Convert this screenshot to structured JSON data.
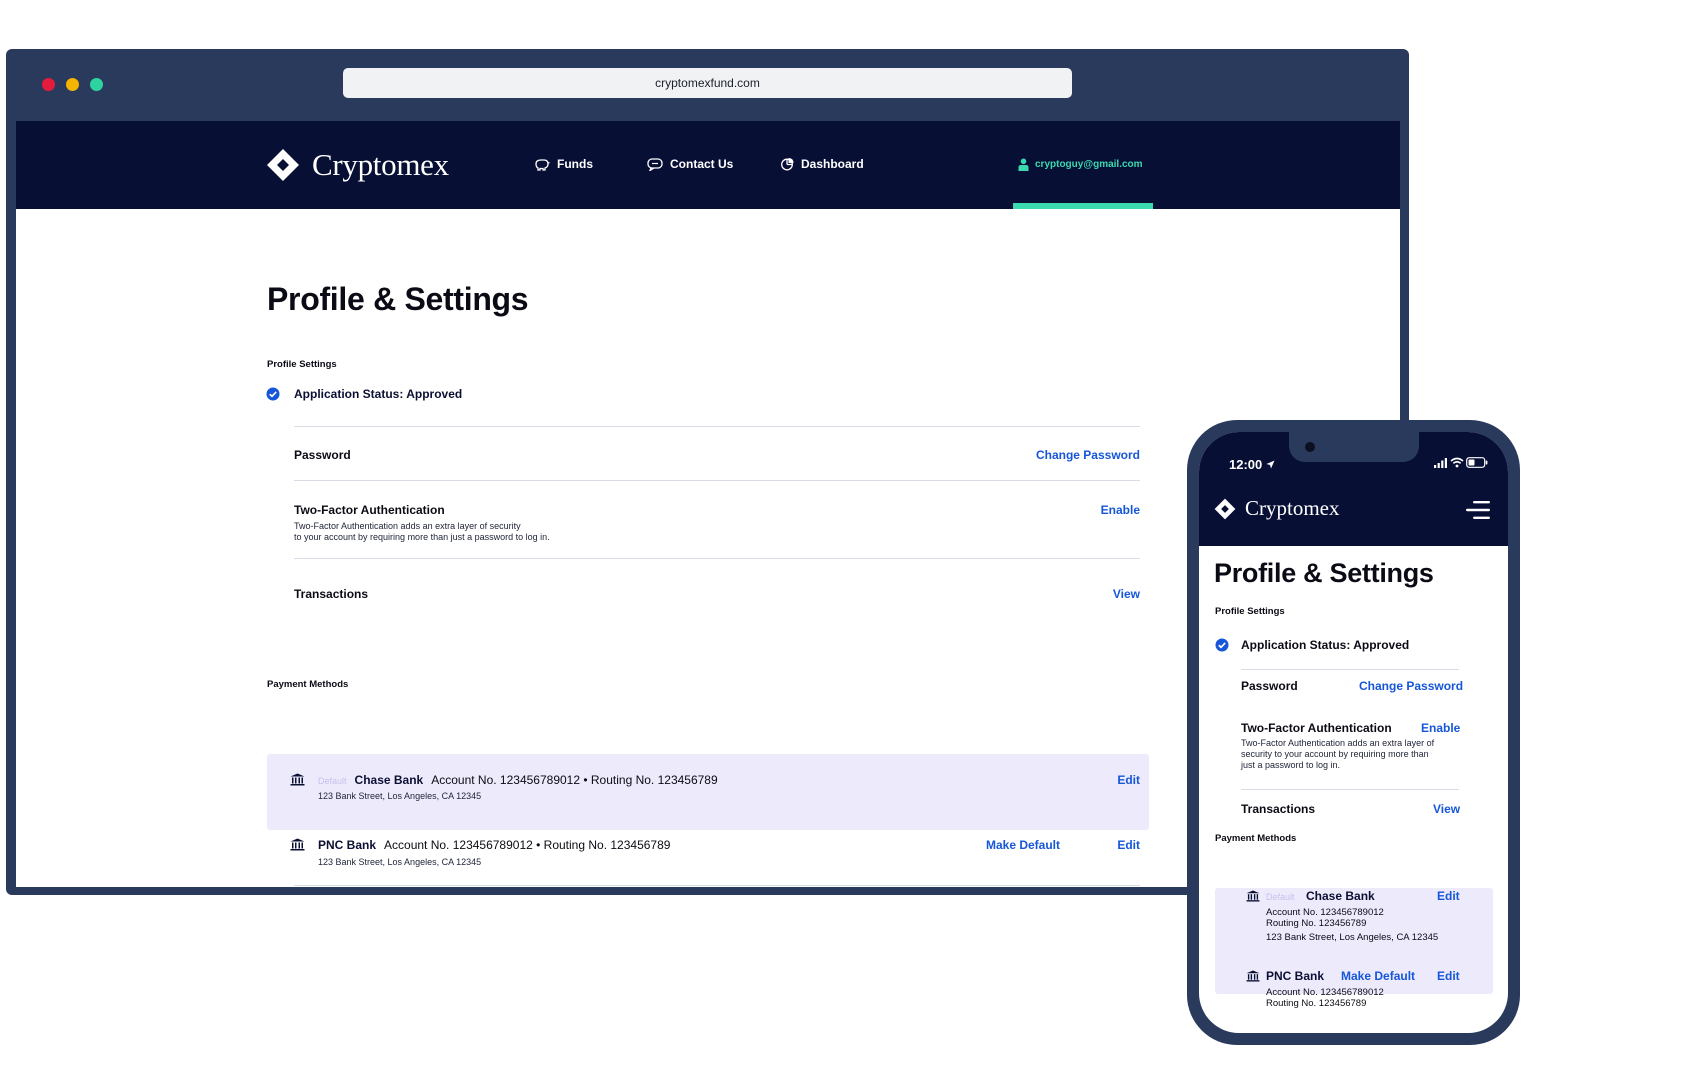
{
  "browser": {
    "url": "cryptomexfund.com",
    "dots": [
      "#e51b3e",
      "#f4b400",
      "#2ed3a0"
    ]
  },
  "nav": {
    "brand": "Cryptomex",
    "items": [
      {
        "label": "Funds",
        "icon": "piggy-bank-icon"
      },
      {
        "label": "Contact Us",
        "icon": "chat-bubble-icon"
      },
      {
        "label": "Dashboard",
        "icon": "pie-chart-icon"
      }
    ],
    "user_email": "cryptoguy@gmail.com",
    "accent": "#3ad9b0"
  },
  "page": {
    "title": "Profile & Settings",
    "profile_section_label": "Profile Settings",
    "status": "Application Status: Approved",
    "rows": [
      {
        "label": "Password",
        "action": "Change Password"
      },
      {
        "label": "Two-Factor Authentication",
        "action": "Enable",
        "desc_line1": "Two-Factor Authentication adds an extra layer of security",
        "desc_line2": "to your account by requiring more than just a password to log in."
      },
      {
        "label": "Transactions",
        "action": "View"
      }
    ],
    "payment_section_label": "Payment Methods",
    "payments": [
      {
        "default_tag": "Default",
        "bank": "Chase Bank",
        "account": "Account No. 123456789012 • Routing No. 123456789",
        "address": "123 Bank Street, Los Angeles, CA 12345",
        "edit": "Edit"
      },
      {
        "bank": "PNC Bank",
        "account": "Account No. 123456789012 • Routing No. 123456789",
        "address": "123 Bank Street, Los Angeles, CA 12345",
        "make_default": "Make Default",
        "edit": "Edit"
      }
    ]
  },
  "phone": {
    "time": "12:00",
    "brand": "Cryptomex",
    "title": "Profile & Settings",
    "profile_section_label": "Profile Settings",
    "status": "Application Status: Approved",
    "password_label": "Password",
    "password_action": "Change Password",
    "twofa_label": "Two-Factor Authentication",
    "twofa_action": "Enable",
    "twofa_desc_1": "Two-Factor Authentication adds an extra layer of",
    "twofa_desc_2": "security to your account by requiring more than",
    "twofa_desc_3": "just a password to log in.",
    "transactions_label": "Transactions",
    "transactions_action": "View",
    "payment_section_label": "Payment Methods",
    "chase": {
      "default_tag": "Default",
      "bank": "Chase Bank",
      "edit": "Edit",
      "account": "Account No. 123456789012",
      "routing": "Routing No. 123456789",
      "address": "123 Bank Street, Los Angeles, CA 12345"
    },
    "pnc": {
      "bank": "PNC Bank",
      "make_default": "Make Default",
      "edit": "Edit",
      "account": "Account No. 123456789012",
      "routing": "Routing No. 123456789"
    }
  }
}
